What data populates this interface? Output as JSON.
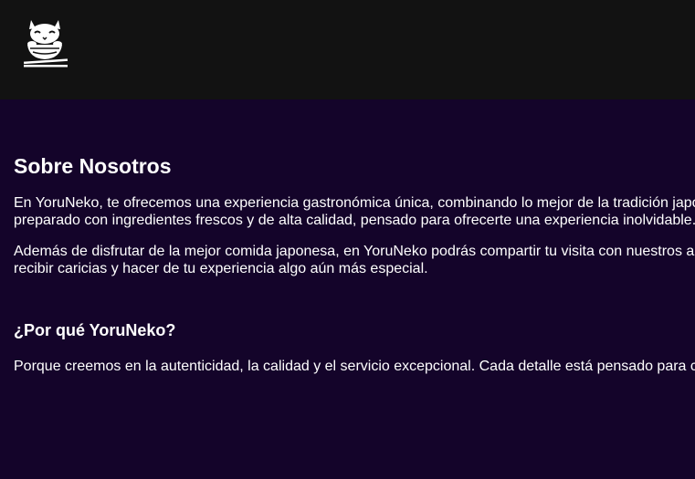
{
  "header": {
    "logo_icon": "cat-ramen-chopsticks-icon",
    "background_color": "#121212"
  },
  "page": {
    "background_color": "#14042a",
    "text_color": "#ffffff"
  },
  "about": {
    "title": "Sobre Nosotros",
    "paragraph1_line1": "En YoruNeko, te ofrecemos una experiencia gastronómica única, combinando lo mejor de la tradición japo",
    "paragraph1_line2": "preparado con ingredientes frescos y de alta calidad, pensado para ofrecerte una experiencia inolvidable.",
    "paragraph2_line1": "Además de disfrutar de la mejor comida japonesa, en YoruNeko podrás compartir tu visita con nuestros a",
    "paragraph2_line2": "recibir caricias y hacer de tu experiencia algo aún más especial."
  },
  "why": {
    "title": "¿Por qué YoruNeko?",
    "paragraph_line1": "Porque creemos en la autenticidad, la calidad y el servicio excepcional. Cada detalle está pensado para c"
  }
}
